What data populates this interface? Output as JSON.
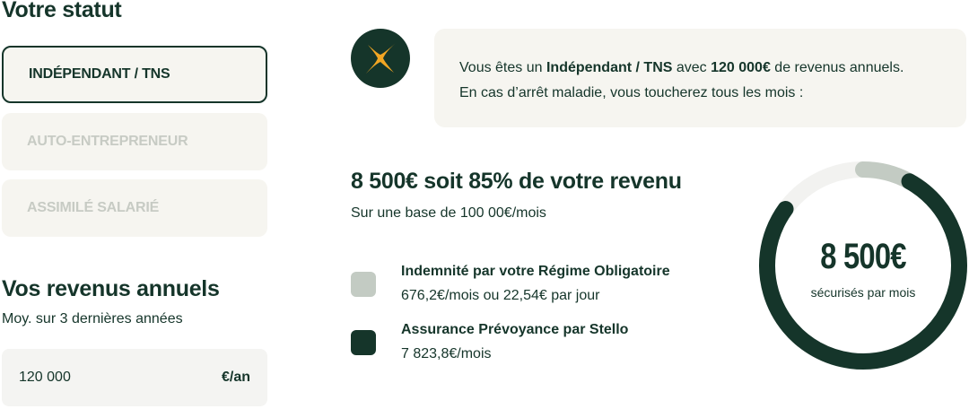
{
  "status_section": {
    "title": "Votre statut",
    "options": [
      {
        "label": "INDÉPENDANT / TNS",
        "selected": true
      },
      {
        "label": "AUTO-ENTREPRENEUR",
        "selected": false
      },
      {
        "label": "ASSIMILÉ SALARIÉ",
        "selected": false
      }
    ]
  },
  "revenue_section": {
    "title": "Vos revenus annuels",
    "subtitle": "Moy. sur 3 dernières années",
    "input_value": "120 000",
    "unit": "€/an"
  },
  "info": {
    "prefix": "Vous êtes un ",
    "status": "Indépendant / TNS",
    "middle": " avec ",
    "amount": "120 000€",
    "suffix": " de revenus annuels.",
    "line2": "En cas d’arrêt maladie, vous toucherez tous les mois :"
  },
  "result": {
    "headline": "8 500€ soit 85% de votre revenu",
    "base": "Sur une base de 100 00€/mois"
  },
  "legend": [
    {
      "title": "Indemnité par votre Régime Obligatoire",
      "detail": "676,2€/mois ou 22,54€ par jour",
      "color": "#c3cbc3"
    },
    {
      "title": "Assurance Prévoyance par Stello",
      "detail": "7 823,8€/mois",
      "color": "#15352a"
    }
  ],
  "gauge": {
    "value_text": "8 500€",
    "label": "sécurisés par mois",
    "regime_fraction": 0.08,
    "coverage_fraction": 0.85,
    "colors": {
      "track": "#f2f2f0",
      "regime": "#c3cbc3",
      "prevoyance": "#15352a"
    }
  },
  "colors": {
    "primary": "#15352a",
    "accent": "#f2a623",
    "panel": "#f6f5f0"
  },
  "logo_icon": "sparkle-icon"
}
